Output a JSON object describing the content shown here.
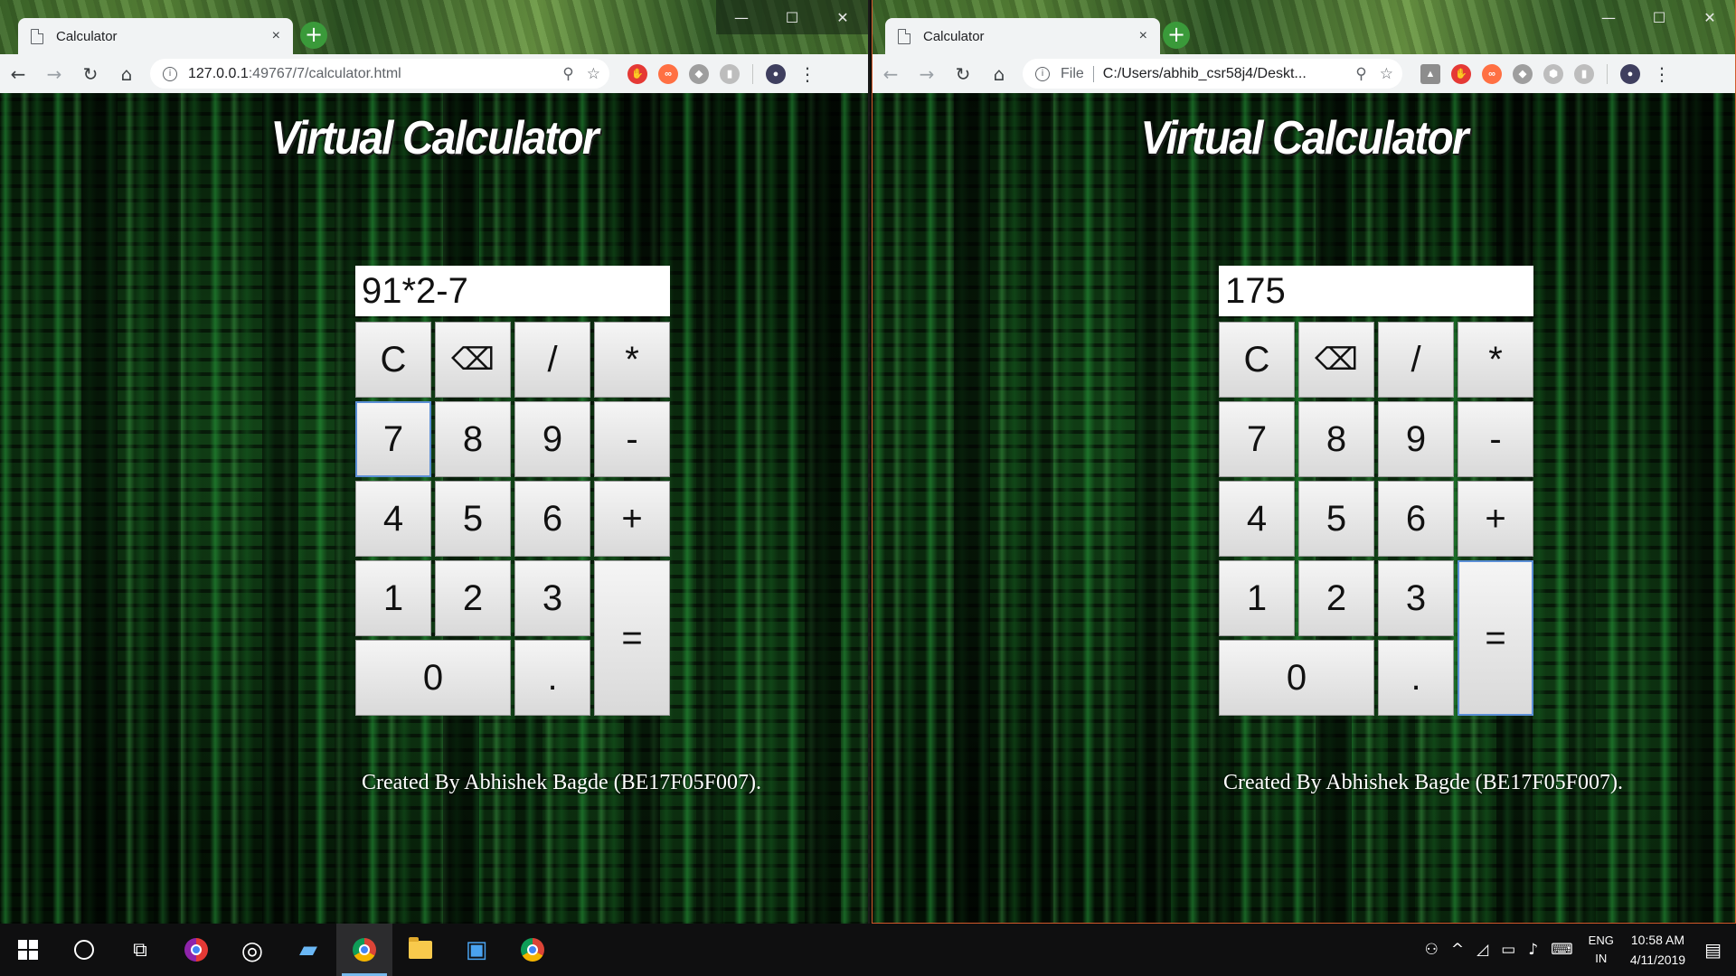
{
  "windows": [
    {
      "tab_title": "Calculator",
      "tab_close": "×",
      "new_tab": "+",
      "url_host": "127.0.0.1",
      "url_path": ":49767/7/calculator.html",
      "file_chip": "",
      "heading": "Virtual Calculator",
      "display_value": "91*2-7",
      "credit": "Created By Abhishek Bagde (BE17F05F007)."
    },
    {
      "tab_title": "Calculator",
      "tab_close": "×",
      "new_tab": "+",
      "url_host": "C:/Users/abhib_csr58j4/Deskt...",
      "url_path": "",
      "file_chip": "File",
      "heading": "Virtual Calculator",
      "display_value": "175",
      "credit": "Created By Abhishek Bagde (BE17F05F007)."
    }
  ],
  "keys": {
    "clear": "C",
    "backspace": "⌫",
    "divide": "/",
    "multiply": "*",
    "seven": "7",
    "eight": "8",
    "nine": "9",
    "minus": "-",
    "four": "4",
    "five": "5",
    "six": "6",
    "plus": "+",
    "one": "1",
    "two": "2",
    "three": "3",
    "equals": "=",
    "zero": "0",
    "dot": "."
  },
  "window_controls": {
    "minimize": "—",
    "maximize": "☐",
    "close": "✕"
  },
  "taskbar": {
    "language_line1": "ENG",
    "language_line2": "IN",
    "time": "10:58 AM",
    "date": "4/11/2019"
  },
  "colors": {
    "accent_focus": "#5b8fd6",
    "new_tab_button": "#3a9a3a",
    "matrix_green": "#28a03c"
  }
}
